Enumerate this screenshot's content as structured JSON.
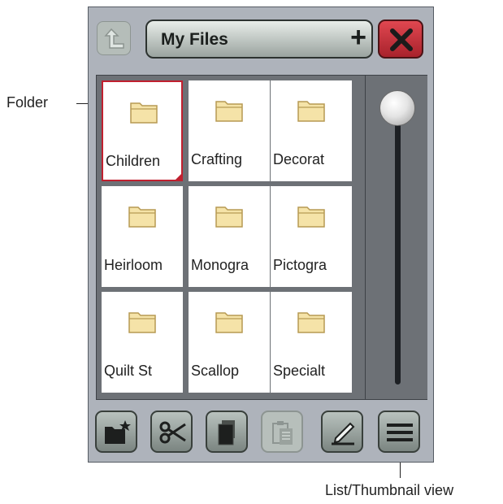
{
  "callouts": {
    "folder": "Folder",
    "list_thumbnail": "List/Thumbnail view"
  },
  "header": {
    "title": "My Files",
    "add_symbol": "+"
  },
  "files": [
    {
      "name": "Children",
      "selected": true
    },
    {
      "name": "Crafting"
    },
    {
      "name": "Decorat"
    },
    {
      "name": "Heirloom"
    },
    {
      "name": "Monogra"
    },
    {
      "name": "Pictogra"
    },
    {
      "name": "Quilt St"
    },
    {
      "name": "Scallop"
    },
    {
      "name": "Specialt"
    }
  ],
  "toolbar": {
    "buttons": [
      "new-folder-icon",
      "cut-icon",
      "copy-icon",
      "paste-icon",
      "rename-icon",
      "list-view-icon"
    ],
    "paste_disabled": true
  },
  "colors": {
    "close_red": "#c0202f",
    "folder_fill": "#f5e3a8"
  }
}
